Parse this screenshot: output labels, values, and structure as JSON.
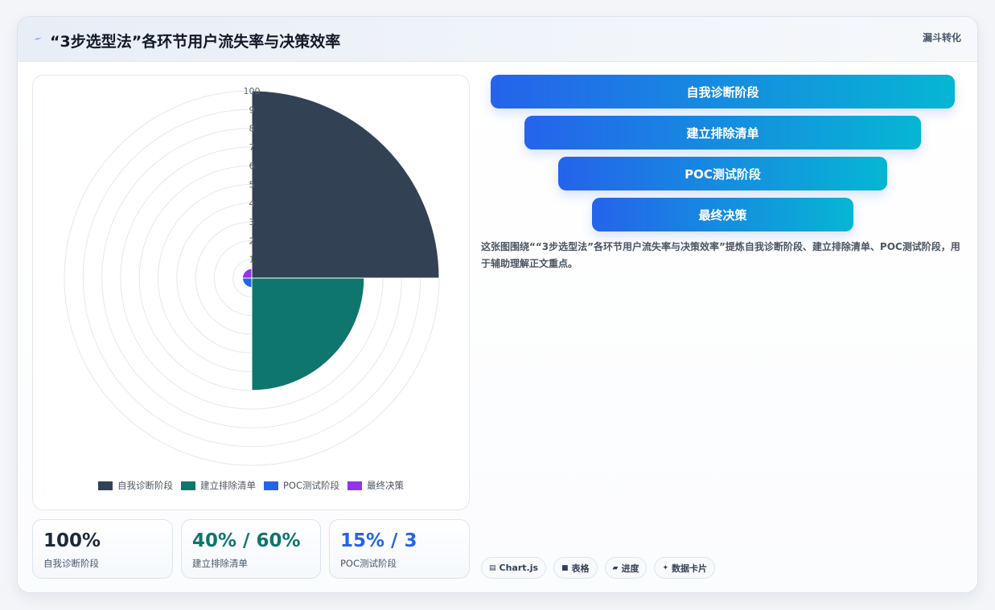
{
  "header": {
    "title": "“3步选型法”各环节用户流失率与决策效率",
    "tag": "漏斗转化"
  },
  "chart_data": {
    "type": "polarArea",
    "categories": [
      "自我诊断阶段",
      "建立排除清单",
      "POC测试阶段",
      "最终决策"
    ],
    "values": [
      100,
      60,
      5,
      5
    ],
    "colors": [
      "#334155",
      "#0f766e",
      "#2563eb",
      "#9333ea"
    ],
    "r_ticks": [
      "100",
      "9",
      "8",
      "7",
      "6",
      "5",
      "4",
      "3",
      "2",
      "1"
    ],
    "rlim": [
      0,
      100
    ],
    "grid": true,
    "legend_position": "bottom"
  },
  "stats": [
    {
      "value": "100%",
      "label": "自我诊断阶段",
      "color": "#1e293b"
    },
    {
      "value": "40% / 60%",
      "label": "建立排除清单",
      "color": "#0f766e"
    },
    {
      "value": "15% / 3",
      "label": "POC测试阶段",
      "color": "#2563eb"
    }
  ],
  "funnel": [
    "自我诊断阶段",
    "建立排除清单",
    "POC测试阶段",
    "最终决策"
  ],
  "description": "这张图围绕““3步选型法”各环节用户流失率与决策效率”提炼自我诊断阶段、建立排除清单、POC测试阶段，用于辅助理解正文重点。",
  "tags": [
    {
      "icon": "▤",
      "icon_name": "chart-icon",
      "label": "Chart.js"
    },
    {
      "icon": "■",
      "icon_name": "table-icon",
      "label": "表格"
    },
    {
      "icon": "▰",
      "icon_name": "progress-icon",
      "label": "进度"
    },
    {
      "icon": "✦",
      "icon_name": "sparkle-icon",
      "label": "数据卡片"
    }
  ]
}
